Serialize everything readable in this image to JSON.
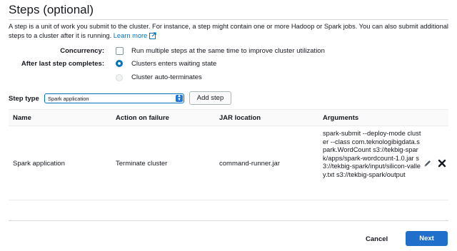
{
  "section": {
    "title": "Steps (optional)",
    "description": "A step is a unit of work you submit to the cluster. For instance, a step might contain one or more Hadoop or Spark jobs. You can also submit additional steps to a cluster after it is running.",
    "learn_more": "Learn more"
  },
  "concurrency": {
    "label": "Concurrency:",
    "option": "Run multiple steps at the same time to improve cluster utilization",
    "checked": false
  },
  "after_last_step": {
    "label": "After last step completes:",
    "options": [
      {
        "label": "Clusters enters waiting state",
        "selected": true
      },
      {
        "label": "Cluster auto-terminates",
        "selected": false
      }
    ]
  },
  "step_type": {
    "label": "Step type",
    "selected": "Spark application",
    "add_button": "Add step"
  },
  "table": {
    "headers": [
      "Name",
      "Action on failure",
      "JAR location",
      "Arguments"
    ],
    "rows": [
      {
        "name": "Spark application",
        "action_on_failure": "Terminate cluster",
        "jar_location": "command-runner.jar",
        "arguments": "spark-submit --deploy-mode cluster --class com.teknologibigdata.spark.WordCount s3://tekbig-spark/apps/spark-wordcount-1.0.jar s3://tekbig-spark/input/silicon-valley.txt s3://tekbig-spark/output"
      }
    ]
  },
  "footer": {
    "cancel": "Cancel",
    "next": "Next"
  },
  "colors": {
    "accent": "#0073bb",
    "primary_button": "#1f6fcb"
  }
}
